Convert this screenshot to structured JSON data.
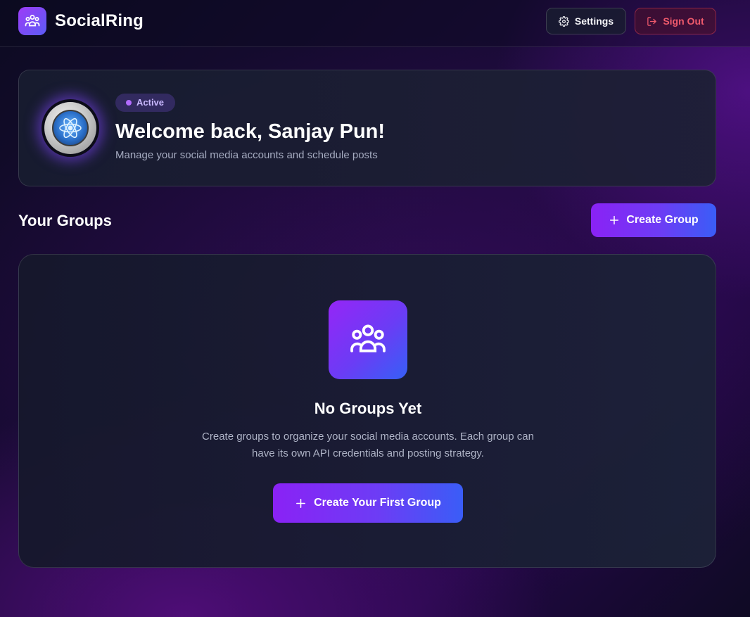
{
  "header": {
    "brand": "SocialRing",
    "settings_label": "Settings",
    "signout_label": "Sign Out"
  },
  "welcome": {
    "status": "Active",
    "title": "Welcome back, Sanjay Pun!",
    "subtitle": "Manage your social media accounts and schedule posts"
  },
  "groups": {
    "title": "Your Groups",
    "create_label": "Create Group"
  },
  "empty_state": {
    "title": "No Groups Yet",
    "description": "Create groups to organize your social media accounts. Each group can have its own API credentials and posting strategy.",
    "cta_label": "Create Your First Group"
  },
  "icons": {
    "logo": "users-icon",
    "settings": "gear-icon",
    "signout": "logout-icon",
    "avatar": "atom-icon",
    "plus": "plus-icon",
    "empty": "users-icon"
  },
  "colors": {
    "accent_start": "#8a22f5",
    "accent_end": "#3a5df7",
    "status_dot": "#b36cff",
    "danger": "#f05a6c"
  }
}
